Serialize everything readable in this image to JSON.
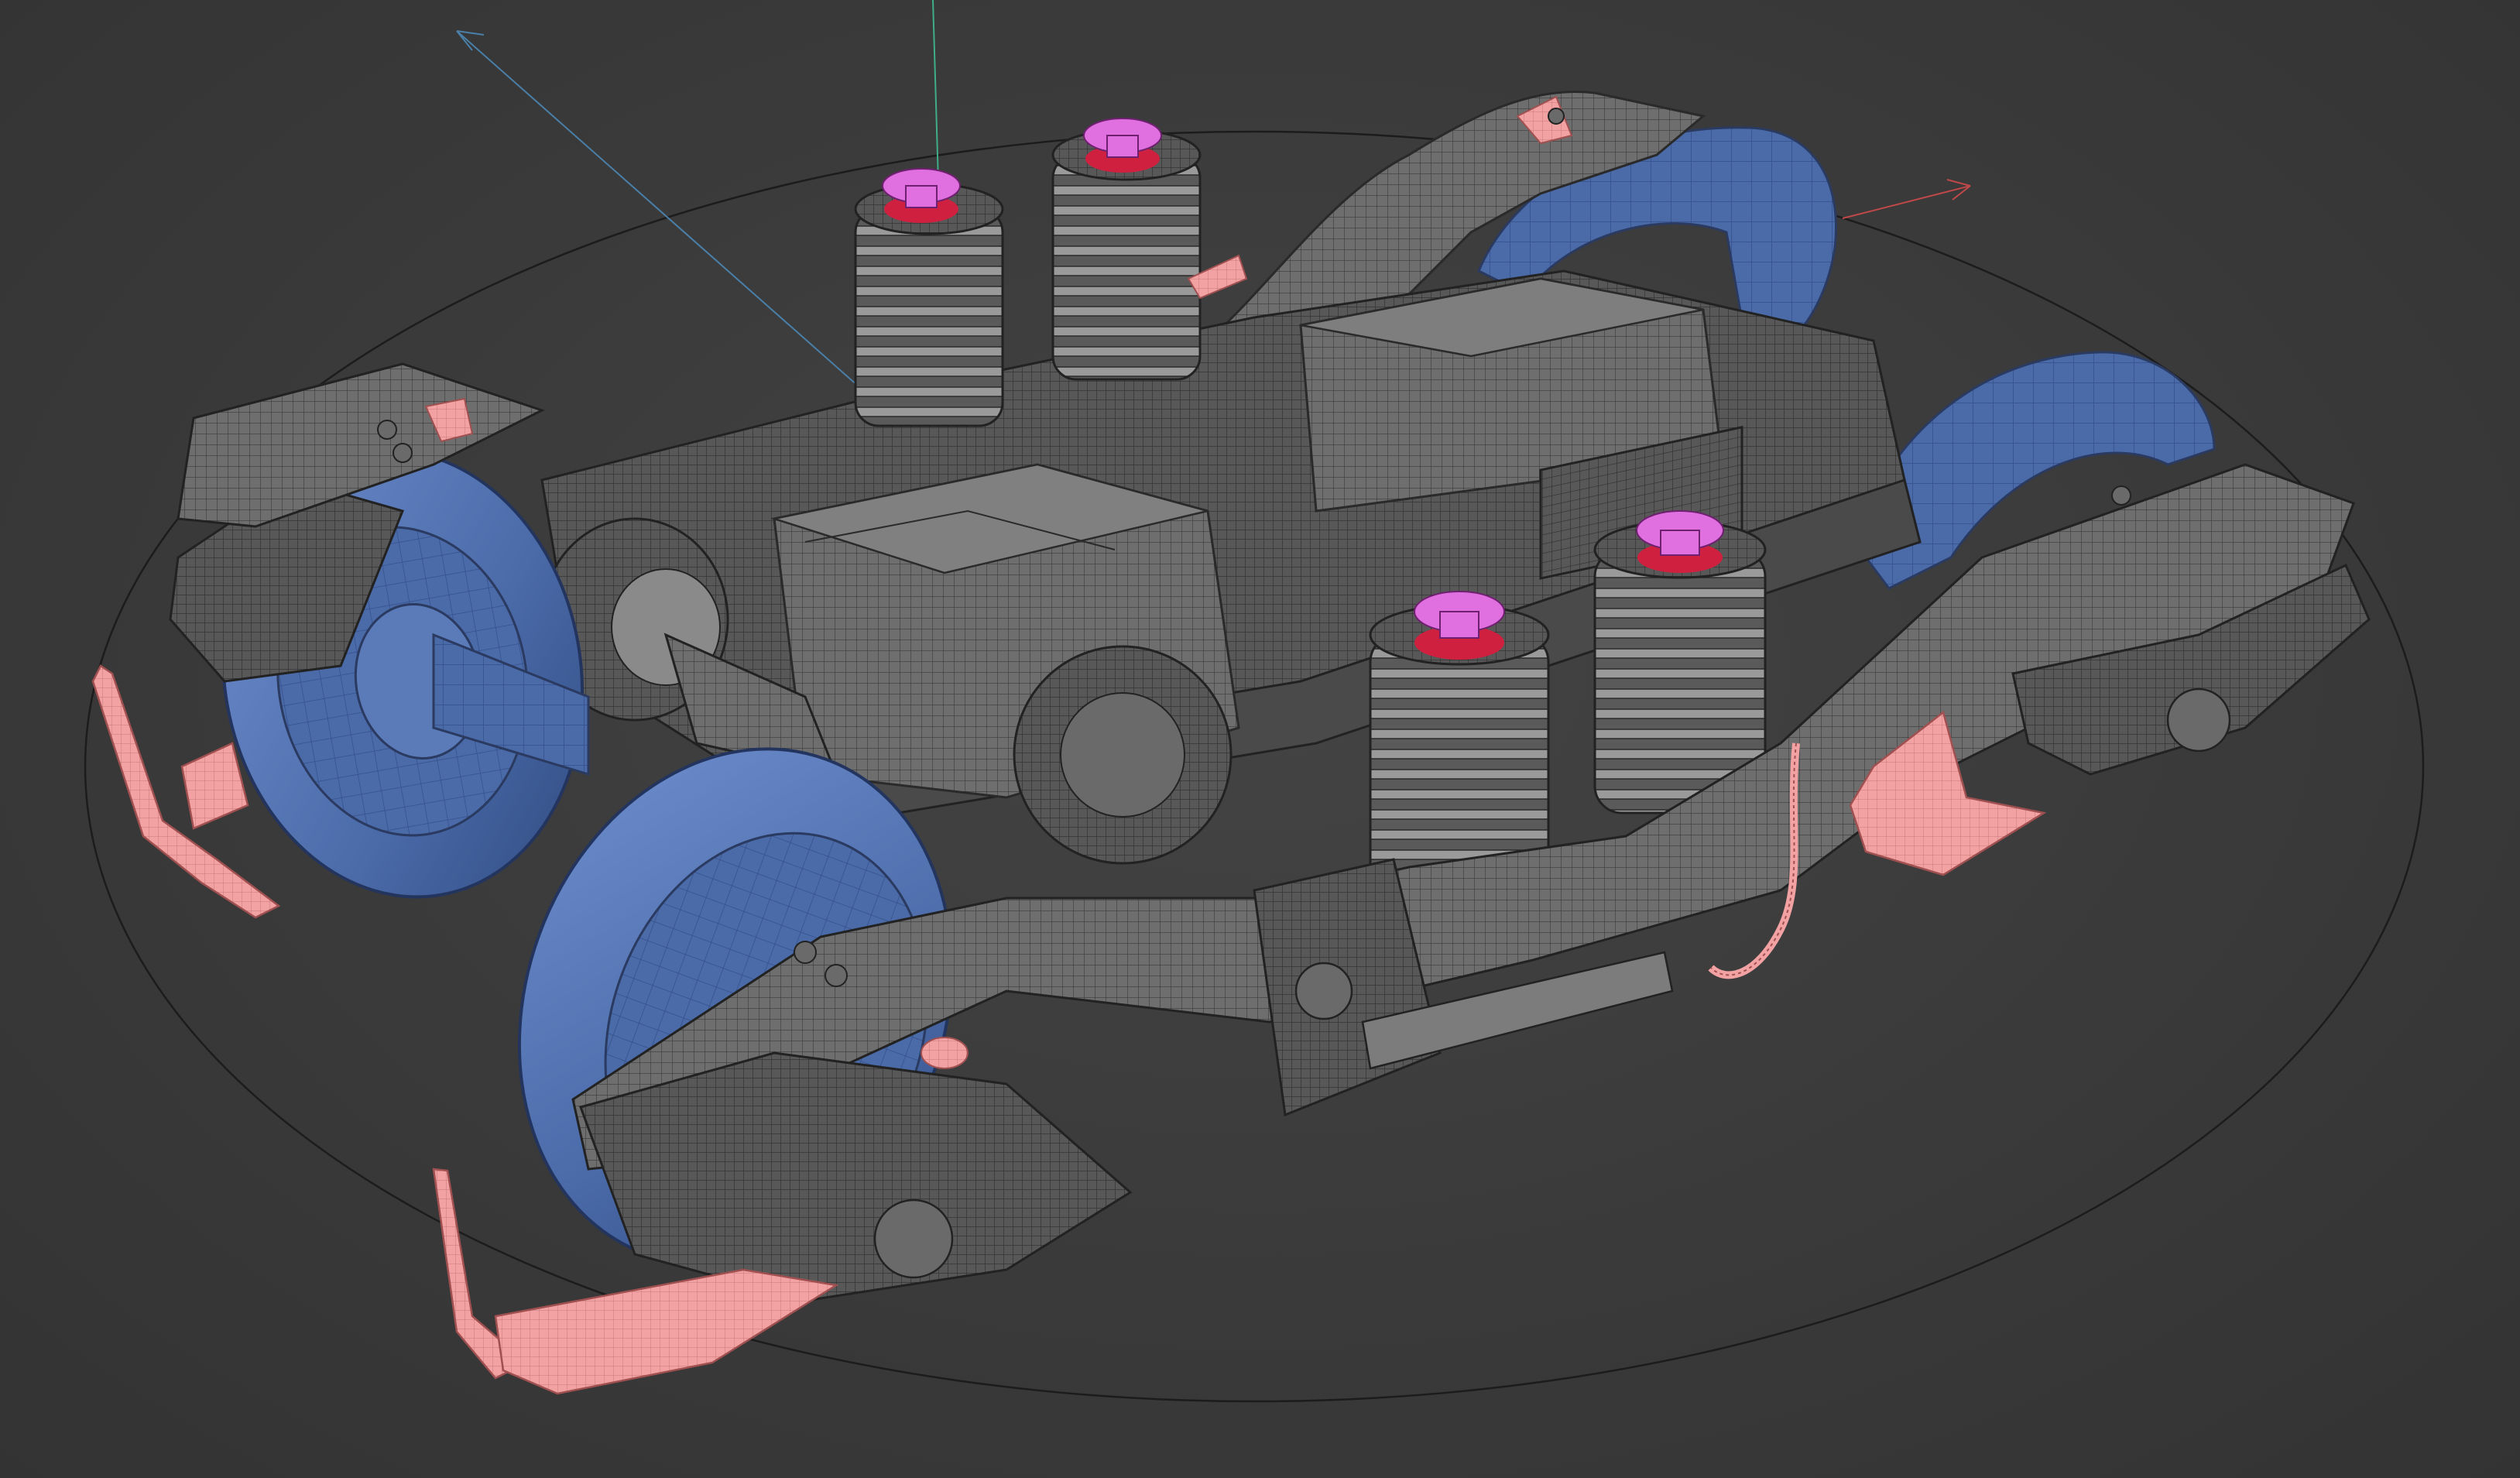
{
  "viewport": {
    "background_color": "#3b3b3b",
    "grid_circle_color": "#1e1e1e",
    "axes": {
      "x_color": "#c04848",
      "y_color": "#3fae86",
      "z_color": "#4a7fa8"
    }
  },
  "model": {
    "name": "",
    "materials": {
      "body_gray": "#6e6e6e",
      "body_gray_dark": "#555555",
      "body_gray_light": "#8a8a8a",
      "wireframe": "#2a2a2a",
      "wheel_blue": "#4a6aa8",
      "wheel_blue_light": "#6c8cc8",
      "selected_pink": "#f4a0a0",
      "spring_top_magenta": "#e070e0",
      "spring_top_red": "#d02040"
    },
    "parts": [
      "frame",
      "wheel-front-left",
      "wheel-front-right",
      "wheel-rear-left",
      "wheel-rear-right",
      "axle-front",
      "motor-front",
      "motor-rear",
      "spring-front-left",
      "spring-front-right",
      "spring-rear-left",
      "spring-rear-right",
      "sand-pipe-left",
      "sand-pipe-right",
      "step-plate",
      "brake-cable"
    ]
  }
}
